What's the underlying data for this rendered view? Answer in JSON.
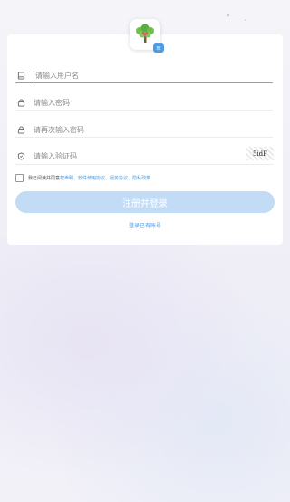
{
  "form": {
    "username_placeholder": "请输入用户名",
    "password_placeholder": "请输入密码",
    "confirm_placeholder": "请再次输入密码",
    "captcha_placeholder": "请输入验证码",
    "captcha_text": "5idF"
  },
  "agreement": {
    "prefix": "我已阅读并同意",
    "links": [
      "权声明、",
      "软件使用协议、",
      "服务协议、",
      "隐私政策"
    ]
  },
  "buttons": {
    "register": "注册并登录",
    "login": "登录已有账号"
  },
  "logo": {
    "badge": "≡"
  },
  "colors": {
    "accent": "#4a9ce8",
    "button_bg": "#c3dcf5"
  }
}
